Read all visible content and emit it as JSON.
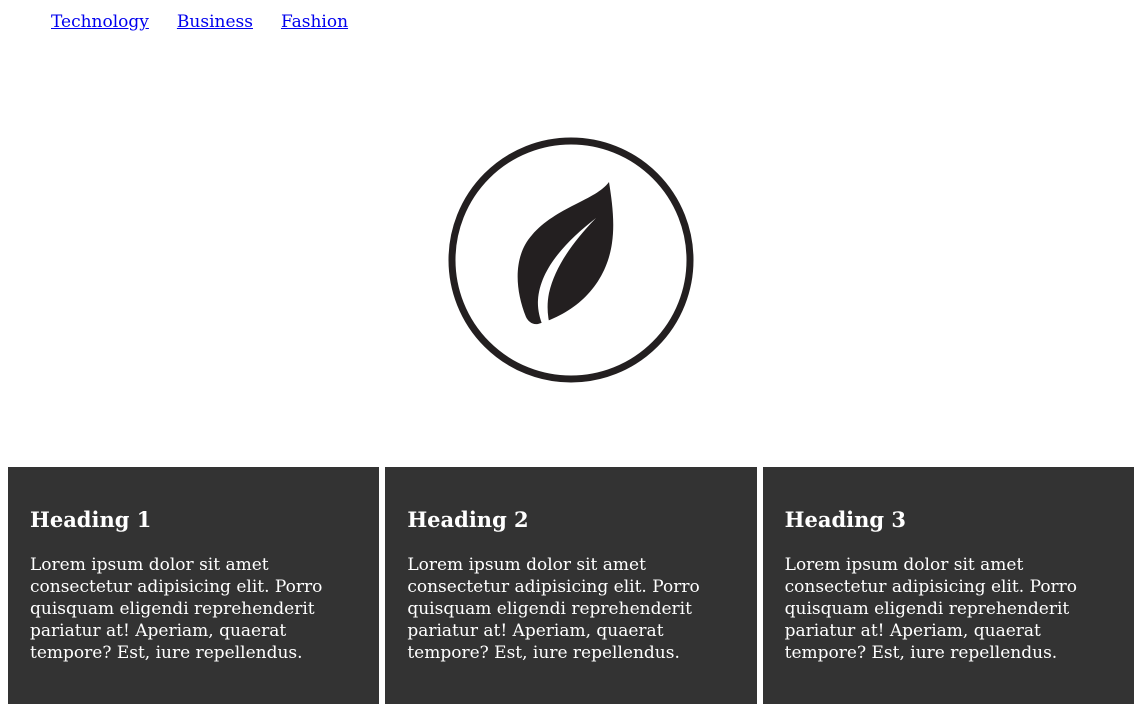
{
  "nav": {
    "links": [
      "Technology",
      "Business",
      "Fashion"
    ]
  },
  "logo": {
    "icon": "leaf-icon",
    "color": "#231f20"
  },
  "cards": [
    {
      "heading": "Heading 1",
      "text": "Lorem ipsum dolor sit amet consectetur adipisicing elit. Porro quisquam eligendi reprehenderit pariatur at! Aperiam, quaerat tempore? Est, iure repellendus."
    },
    {
      "heading": "Heading 2",
      "text": "Lorem ipsum dolor sit amet consectetur adipisicing elit. Porro quisquam eligendi reprehenderit pariatur at! Aperiam, quaerat tempore? Est, iure repellendus."
    },
    {
      "heading": "Heading 3",
      "text": "Lorem ipsum dolor sit amet consectetur adipisicing elit. Porro quisquam eligendi reprehenderit pariatur at! Aperiam, quaerat tempore? Est, iure repellendus."
    }
  ],
  "colors": {
    "card_bg": "#333333",
    "card_text": "#ffffff",
    "link": "#0000ee"
  }
}
